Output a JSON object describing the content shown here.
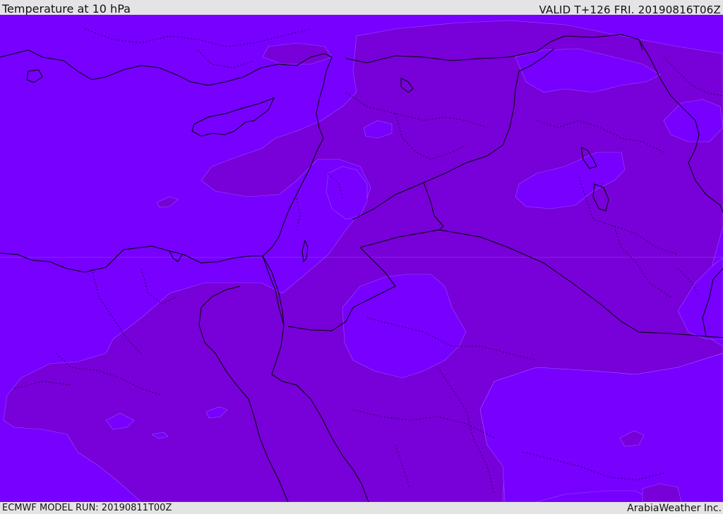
{
  "header": {
    "title": "Temperature at 10 hPa",
    "valid_time": "VALID T+126 FRI. 20190816T06Z"
  },
  "footer": {
    "model_run": "ECMWF MODEL RUN: 20190811T00Z",
    "credit": "ArabiaWeather Inc."
  },
  "colors": {
    "band_warm": "#7700ff",
    "band_cool": "#7800d8",
    "coastline": "#000000",
    "border": "#000000"
  }
}
